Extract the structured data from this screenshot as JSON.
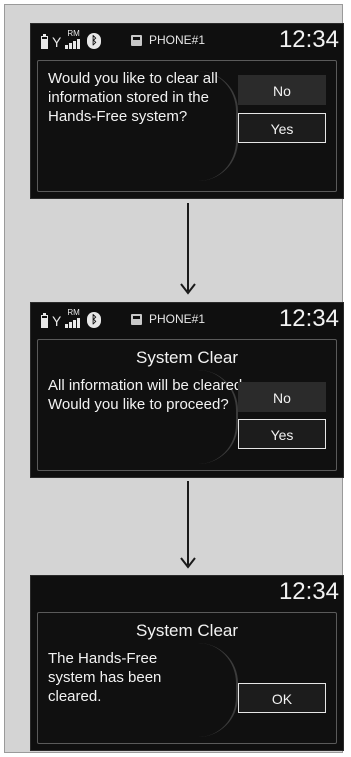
{
  "screens": [
    {
      "status": {
        "phone_label": "PHONE#1",
        "rm_label": "RM",
        "clock": "12:34"
      },
      "message": "Would you like to clear all information stored in the Hands-Free system?",
      "buttons": {
        "no": "No",
        "yes": "Yes"
      }
    },
    {
      "status": {
        "phone_label": "PHONE#1",
        "rm_label": "RM",
        "clock": "12:34"
      },
      "title": "System Clear",
      "message": "All information will be cleared. Would you like to proceed?",
      "buttons": {
        "no": "No",
        "yes": "Yes"
      }
    },
    {
      "status": {
        "clock": "12:34"
      },
      "title": "System Clear",
      "message": "The Hands-Free system has been cleared.",
      "buttons": {
        "ok": "OK"
      }
    }
  ],
  "icons": {
    "battery": "battery-icon",
    "antenna": "antenna-icon",
    "signal": "signal-strength-icon",
    "bluetooth": "bluetooth-icon",
    "phone": "phone-icon",
    "arrow": "arrow-down-icon"
  },
  "colors": {
    "screen_bg": "#0f0f0f",
    "text": "#f2f2f2",
    "selected_border": "#e6e6e6",
    "frame_bg": "#d4d4d4"
  }
}
